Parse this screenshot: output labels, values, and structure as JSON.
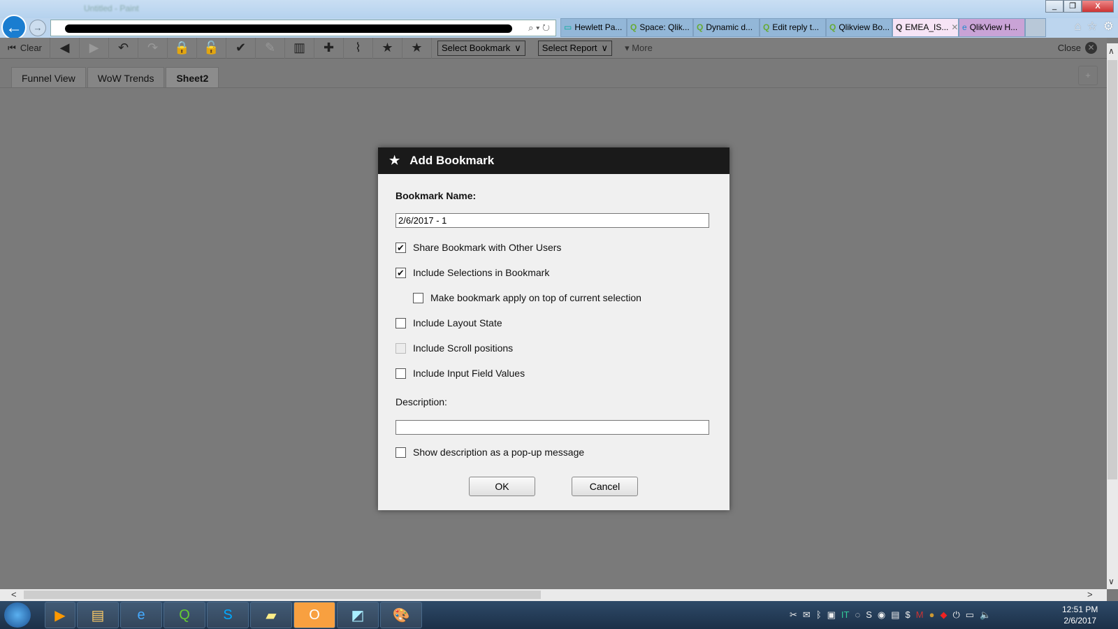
{
  "window": {
    "title": "Untitled - Paint"
  },
  "browser": {
    "tabs": [
      {
        "label": "Hewlett Pa...",
        "icon": "hpe-icon"
      },
      {
        "label": "Space: Qlik...",
        "icon": "qlik-icon"
      },
      {
        "label": "Dynamic d...",
        "icon": "qlik-icon"
      },
      {
        "label": "Edit reply t...",
        "icon": "qlik-icon"
      },
      {
        "label": "Qlikview Bo...",
        "icon": "qlik-icon"
      },
      {
        "label": "EMEA_IS...",
        "icon": "qlik-icon",
        "active": true
      },
      {
        "label": "QlikView H...",
        "icon": "ie-icon"
      }
    ]
  },
  "toolbar": {
    "clear": "Clear",
    "select_bookmark": "Select Bookmark",
    "select_report": "Select Report",
    "more": "More",
    "close": "Close"
  },
  "sheets": [
    "Funnel View",
    "WoW Trends",
    "Sheet2"
  ],
  "dialog": {
    "title": "Add Bookmark",
    "name_label": "Bookmark Name:",
    "name_value": "2/6/2017 - 1",
    "options": [
      {
        "label": "Share Bookmark with Other Users",
        "checked": true
      },
      {
        "label": "Include Selections in Bookmark",
        "checked": true
      },
      {
        "label": "Make bookmark apply on top of current selection",
        "checked": false
      },
      {
        "label": "Include Layout State",
        "checked": false
      },
      {
        "label": "Include Scroll positions",
        "checked": false,
        "disabled": true
      },
      {
        "label": "Include Input Field Values",
        "checked": false
      }
    ],
    "description_label": "Description:",
    "description_value": "",
    "popup_label": "Show description as a pop-up message",
    "popup_checked": false,
    "ok": "OK",
    "cancel": "Cancel"
  },
  "taskbar": {
    "time": "12:51 PM",
    "date": "2/6/2017"
  }
}
